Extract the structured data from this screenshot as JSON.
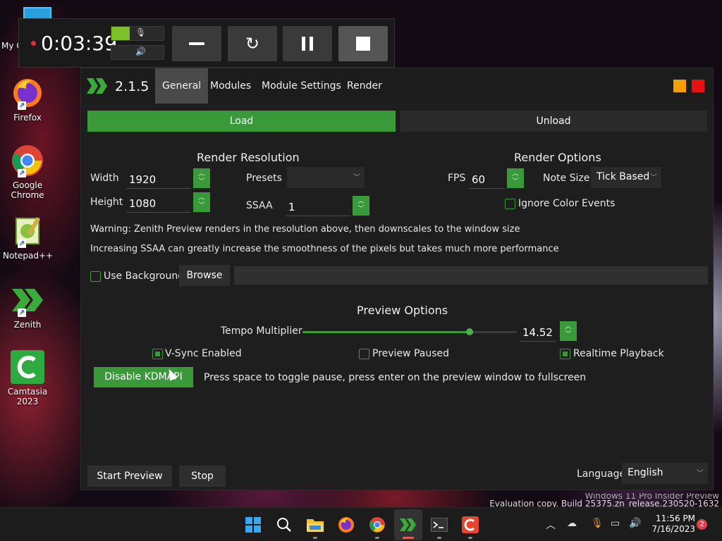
{
  "desktop": {
    "icons": [
      {
        "label": "My C",
        "icon": "this-pc-icon"
      },
      {
        "label": "Firefox",
        "icon": "firefox-icon"
      },
      {
        "label": "Google Chrome",
        "icon": "chrome-icon"
      },
      {
        "label": "Notepad++",
        "icon": "notepad-plus-plus-icon"
      },
      {
        "label": "Zenith",
        "icon": "zenith-icon"
      },
      {
        "label": "Camtasia 2023",
        "icon": "camtasia-icon"
      }
    ]
  },
  "recorder": {
    "time": "0:03:39",
    "mic_level": 0.35,
    "colors": {
      "level": "#7ec02a",
      "record": "#e03040"
    }
  },
  "app": {
    "version": "2.1.5",
    "tabs": [
      "General",
      "Modules",
      "Module Settings",
      "Render"
    ],
    "active_tab": "General",
    "load_label": "Load",
    "unload_label": "Unload",
    "render_resolution": {
      "heading": "Render Resolution",
      "width_label": "Width",
      "width_value": "1920",
      "height_label": "Height",
      "height_value": "1080",
      "presets_label": "Presets",
      "presets_value": "",
      "ssaa_label": "SSAA",
      "ssaa_value": "1"
    },
    "render_options": {
      "heading": "Render Options",
      "fps_label": "FPS",
      "fps_value": "60",
      "note_size_label": "Note Size",
      "note_size_value": "Tick Based",
      "ignore_color_events_label": "Ignore Color Events",
      "ignore_color_events": false
    },
    "warning_text": "Warning: Zenith Preview renders in the resolution above, then downscales to the window size",
    "ssaa_text": "Increasing SSAA can greatly increase the smoothness of the pixels but takes much more performance",
    "use_background_label": "Use Background",
    "use_background": false,
    "browse_label": "Browse",
    "background_path": "",
    "preview_options": {
      "heading": "Preview Options",
      "tempo_label": "Tempo Multiplier",
      "tempo_value": "14.52",
      "tempo_fraction": 0.78,
      "vsync_label": "V-Sync Enabled",
      "vsync": true,
      "paused_label": "Preview Paused",
      "paused": false,
      "realtime_label": "Realtime Playback",
      "realtime": true,
      "kdmapi_label": "Disable KDMAPI",
      "hint_text": "Press space to toggle pause, press enter on the preview window to fullscreen"
    },
    "start_preview_label": "Start Preview",
    "stop_label": "Stop",
    "language_label": "Language",
    "language_value": "English",
    "colors": {
      "accent": "#3a9a3a",
      "minimize": "#f5a000",
      "close": "#e81010"
    }
  },
  "watermark": {
    "line1": "Windows 11 Pro Insider Preview",
    "line2": "Evaluation copy. Build 25375.zn_release.230520-1632"
  },
  "taskbar": {
    "apps": [
      "start-icon",
      "search-icon",
      "file-explorer-icon",
      "firefox-icon",
      "chrome-icon",
      "zenith-icon",
      "terminal-icon",
      "camtasia-icon"
    ],
    "time": "11:56 PM",
    "date": "7/16/2023",
    "notifications": "2"
  }
}
